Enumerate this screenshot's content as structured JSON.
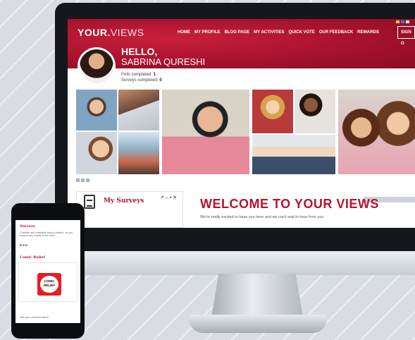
{
  "site": {
    "logo_bold": "YOUR.",
    "logo_light": "VIEWS",
    "nav": [
      "HOME",
      "MY PROFILE",
      "BLOG PAGE",
      "MY ACTIVITIES",
      "QUICK VOTE",
      "OUR FEEDBACK",
      "REWARDS"
    ],
    "sign_out": "SIGN O",
    "greeting": "HELLO,",
    "user_name": "SABRINA QURESHI",
    "polls_label": "Polls completed:",
    "polls_value": "1",
    "surveys_label": "Surveys completed:",
    "surveys_value": "0",
    "widget_title": "My Surveys",
    "widget_controls": "↗ – ▪ ✕",
    "welcome_title": "WELCOME TO YOUR VIEWS",
    "welcome_subtitle": "We're really excited to have you here and we can't wait to hear from you."
  },
  "phone": {
    "section1_title": "Surveys",
    "section1_text": "Charities and charitable lottery retailers, do you support any charity of this kind?",
    "section2_title": "Comic Relief",
    "comic_line1": "COMIC",
    "comic_line2": "RELIEF",
    "footer_text": "Add your comment above"
  },
  "colors": {
    "brand_red": "#b5142f",
    "header_red": "#a6122d",
    "monitor_frame": "#15171a"
  }
}
